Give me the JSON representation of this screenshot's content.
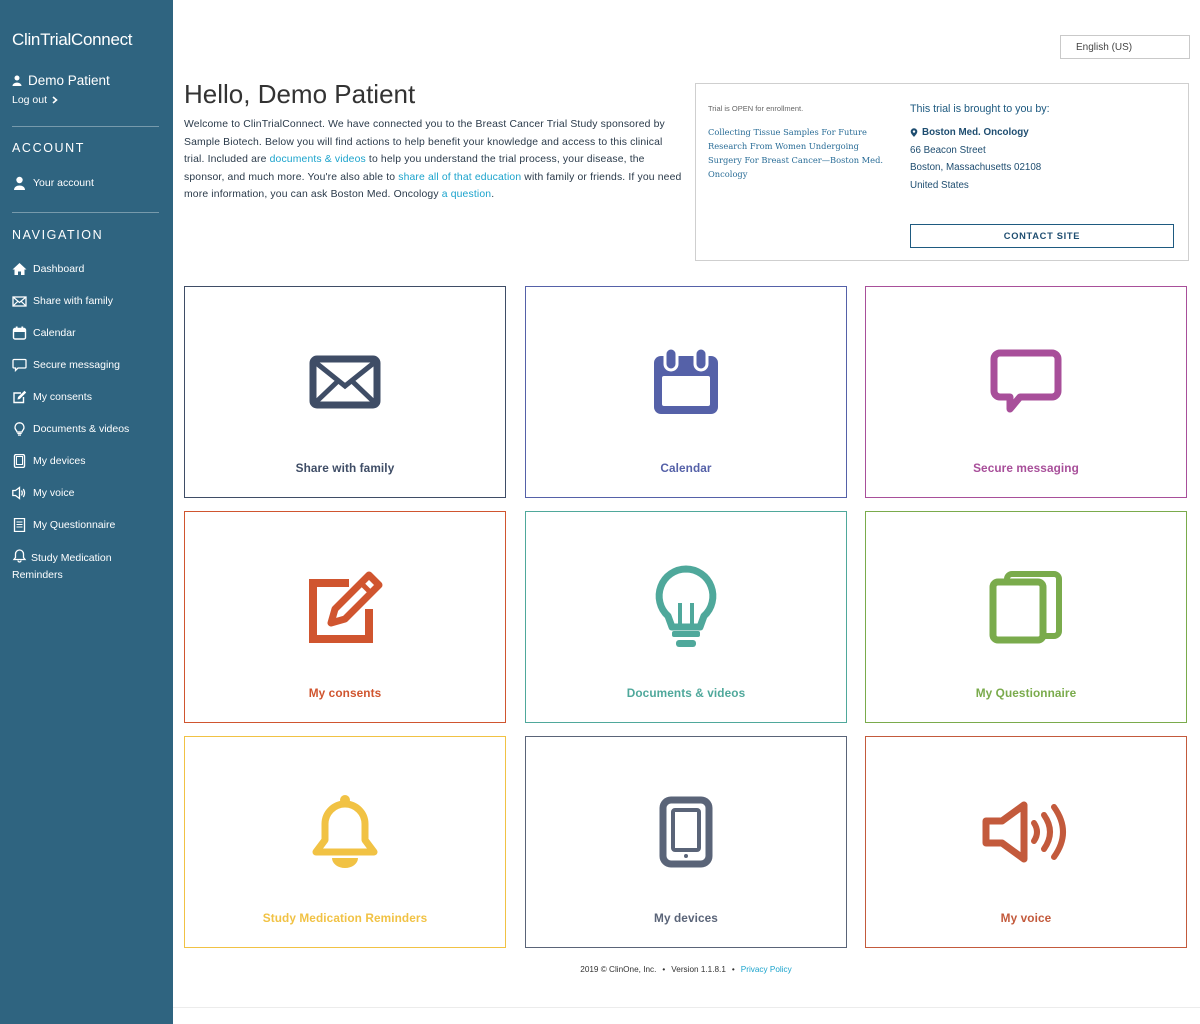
{
  "app": {
    "logo": "ClinTrialConnect"
  },
  "user": {
    "name": "Demo Patient",
    "logout_label": "Log out"
  },
  "sidebar": {
    "account_title": "ACCOUNT",
    "account_item": "Your account",
    "navigation_title": "NAVIGATION",
    "items": [
      {
        "label": "Dashboard",
        "icon": "home-icon"
      },
      {
        "label": "Share with family",
        "icon": "envelope-icon"
      },
      {
        "label": "Calendar",
        "icon": "calendar-icon"
      },
      {
        "label": "Secure messaging",
        "icon": "chat-icon"
      },
      {
        "label": "My consents",
        "icon": "edit-icon"
      },
      {
        "label": "Documents & videos",
        "icon": "lightbulb-icon"
      },
      {
        "label": "My devices",
        "icon": "tablet-icon"
      },
      {
        "label": "My voice",
        "icon": "speaker-icon"
      },
      {
        "label": "My Questionnaire",
        "icon": "list-icon"
      },
      {
        "label": "Study Medication Reminders",
        "icon": "bell-icon"
      }
    ]
  },
  "language": {
    "selected": "English (US)"
  },
  "header": {
    "greeting": "Hello, Demo Patient",
    "welcome_1": "Welcome to ClinTrialConnect. We have connected you to the Breast Cancer Trial Study sponsored by Sample Biotech. Below you will find actions to help benefit your knowledge and access to this clinical trial. Included are ",
    "link_documents": "documents & videos",
    "welcome_2": " to help you understand the trial process, your disease, the sponsor, and much more. You're also able to ",
    "link_share": "share all of that education",
    "welcome_3": " with family or friends. If you need more information, you can ask Boston Med. Oncology ",
    "link_question": "a question",
    "welcome_4": "."
  },
  "trial": {
    "status": "Trial is OPEN for enrollment.",
    "name": "Collecting Tissue Samples For Future Research From Women Undergoing Surgery For Breast Cancer—Boston Med. Oncology",
    "brought_by": "This trial is brought to you by:",
    "site_name": "Boston Med. Oncology",
    "address_line1": "66 Beacon Street",
    "address_line2": "Boston, Massachusetts 02108",
    "address_line3": "United States",
    "contact_button": "CONTACT SITE"
  },
  "tiles": [
    {
      "label": "Share with family",
      "color": "#3f4d66",
      "icon": "envelope-icon"
    },
    {
      "label": "Calendar",
      "color": "#5561a8",
      "icon": "calendar-icon"
    },
    {
      "label": "Secure messaging",
      "color": "#a84f9a",
      "icon": "chat-icon"
    },
    {
      "label": "My consents",
      "color": "#d0552f",
      "icon": "edit-icon"
    },
    {
      "label": "Documents & videos",
      "color": "#4fa89b",
      "icon": "lightbulb-icon"
    },
    {
      "label": "My Questionnaire",
      "color": "#7aab4c",
      "icon": "pages-icon"
    },
    {
      "label": "Study Medication Reminders",
      "color": "#f1c244",
      "icon": "bell-icon"
    },
    {
      "label": "My devices",
      "color": "#5a6478",
      "icon": "tablet-icon"
    },
    {
      "label": "My voice",
      "color": "#c35a3c",
      "icon": "speaker-icon"
    }
  ],
  "footer": {
    "copyright": "2019 © ClinOne, Inc.",
    "version": "Version 1.1.8.1",
    "privacy": "Privacy Policy"
  }
}
